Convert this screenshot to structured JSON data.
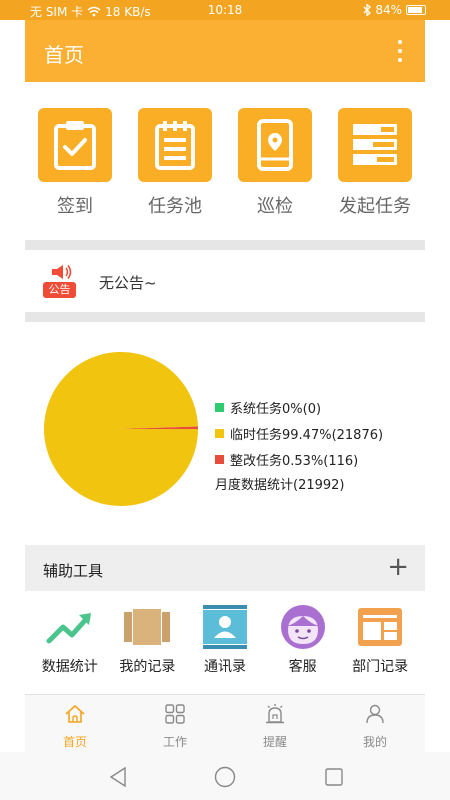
{
  "status_bar": {
    "carrier": "无 SIM 卡",
    "speed": "18 KB/s",
    "time": "10:18",
    "battery": "84%"
  },
  "app_bar": {
    "title": "首页"
  },
  "quick_actions": [
    {
      "label": "签到",
      "icon": "clipboard-check-icon"
    },
    {
      "label": "任务池",
      "icon": "notepad-icon"
    },
    {
      "label": "巡检",
      "icon": "phone-location-icon"
    },
    {
      "label": "发起任务",
      "icon": "list-bars-icon"
    }
  ],
  "notice": {
    "badge": "公告",
    "text": "无公告~"
  },
  "chart_data": {
    "type": "pie",
    "categories": [
      "系统任务",
      "临时任务",
      "整改任务"
    ],
    "values": [
      0,
      21876,
      116
    ],
    "percent": [
      0,
      99.47,
      0.53
    ],
    "legend_labels": [
      "系统任务0%(0)",
      "临时任务99.47%(21876)",
      "整改任务0.53%(116)"
    ],
    "colors": [
      "#2ecc71",
      "#f1c40f",
      "#e74c3c"
    ],
    "caption": "月度数据统计(21992)",
    "legend_position": "right"
  },
  "tools": {
    "title": "辅助工具",
    "add": "+",
    "items": [
      {
        "label": "数据统计",
        "icon": "trend-chart-icon"
      },
      {
        "label": "我的记录",
        "icon": "book-icon"
      },
      {
        "label": "通讯录",
        "icon": "contacts-icon"
      },
      {
        "label": "客服",
        "icon": "face-icon"
      },
      {
        "label": "部门记录",
        "icon": "panel-icon"
      }
    ]
  },
  "bottom_nav": [
    {
      "label": "首页",
      "icon": "home-icon",
      "active": true
    },
    {
      "label": "工作",
      "icon": "grid-icon",
      "active": false
    },
    {
      "label": "提醒",
      "icon": "alarm-icon",
      "active": false
    },
    {
      "label": "我的",
      "icon": "person-icon",
      "active": false
    }
  ]
}
